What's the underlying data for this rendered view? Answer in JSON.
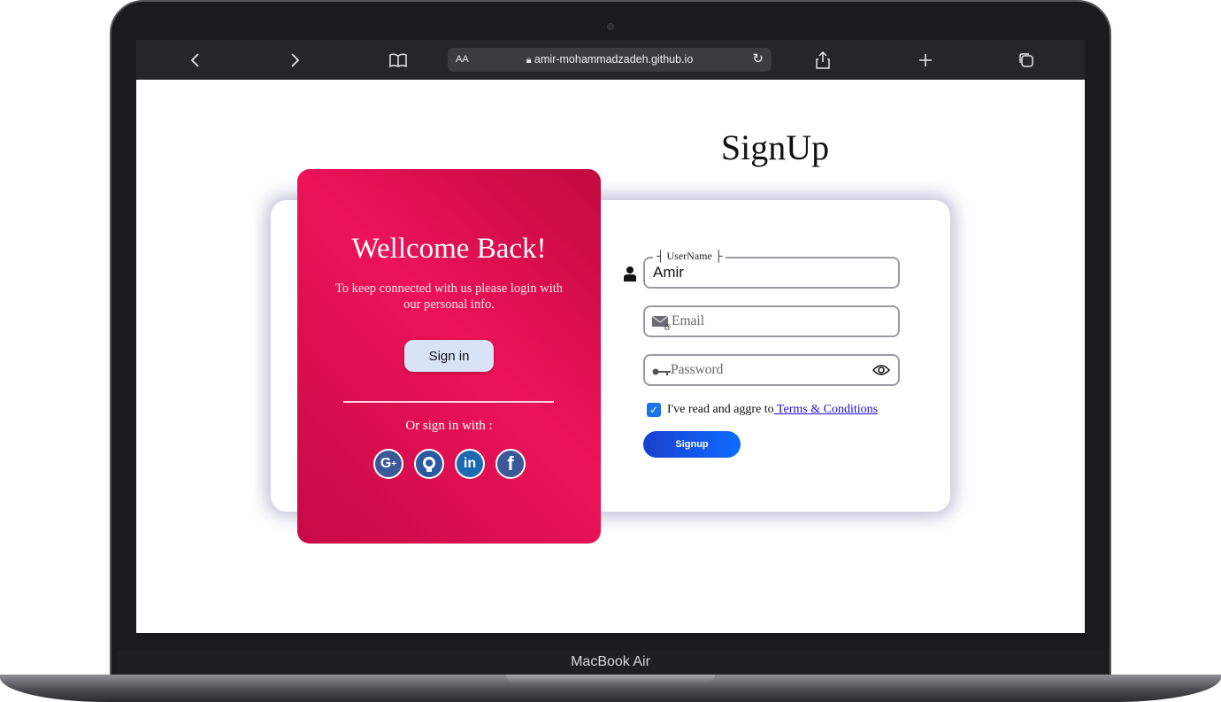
{
  "browser": {
    "text_size": "AA",
    "url": "amir-mohammadzadeh.github.io",
    "back_icon": "chevron-left-icon",
    "forward_icon": "chevron-right-icon",
    "bookmarks_icon": "book-icon",
    "reload_icon": "reload-icon",
    "share_icon": "share-icon",
    "new_tab_icon": "plus-icon",
    "tabs_icon": "tabs-icon"
  },
  "page": {
    "title": "SignUp",
    "welcome": {
      "heading": "Wellcome Back!",
      "subtitle": "To keep connected with us please login with our personal info.",
      "signin_label": "Sign in",
      "or_sign_in_with": "Or sign in with :",
      "socials": [
        "google-plus-icon",
        "github-icon",
        "linkedin-icon",
        "facebook-icon"
      ]
    },
    "form": {
      "username_legend": "UserName",
      "username_value": "Amir",
      "email_placeholder": "Email",
      "password_placeholder": "Password",
      "terms_checked": true,
      "terms_text": "I've read and aggre to",
      "terms_link": " Terms & Conditions",
      "signup_label": "Signup"
    },
    "colors": {
      "panel": "#ec1358",
      "signup_button": "#1a3fcf",
      "sign_in_button": "#d9e3f6"
    }
  },
  "device": {
    "label": "MacBook Air"
  }
}
